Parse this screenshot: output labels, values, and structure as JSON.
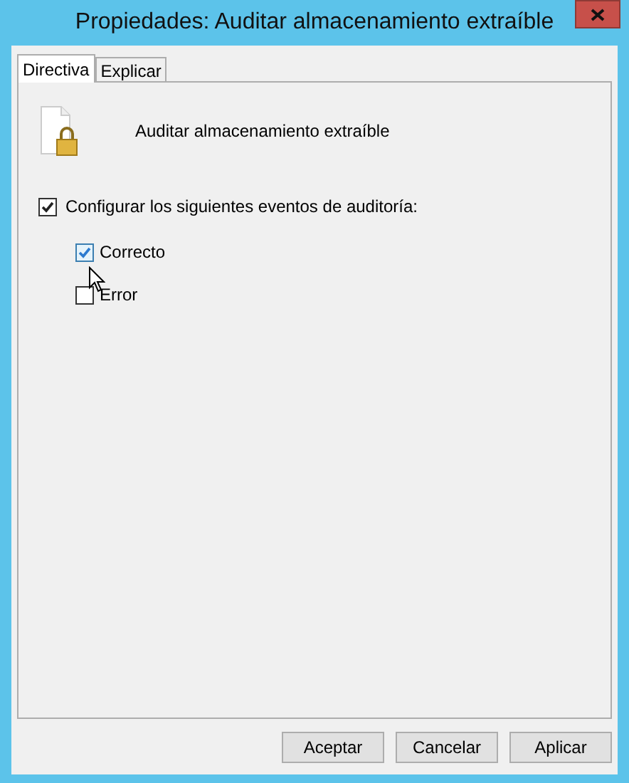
{
  "window": {
    "title": "Propiedades: Auditar almacenamiento extraíble"
  },
  "tabs": [
    {
      "label": "Directiva",
      "selected": true
    },
    {
      "label": "Explicar",
      "selected": false
    }
  ],
  "policy": {
    "name": "Auditar almacenamiento extraíble"
  },
  "configure": {
    "label": "Configurar los siguientes eventos de auditoría:",
    "checked": true
  },
  "events": [
    {
      "label": "Correcto",
      "checked": true,
      "hovered": true
    },
    {
      "label": "Error",
      "checked": false,
      "hovered": false
    }
  ],
  "buttons": [
    "Aceptar",
    "Cancelar",
    "Aplicar"
  ]
}
